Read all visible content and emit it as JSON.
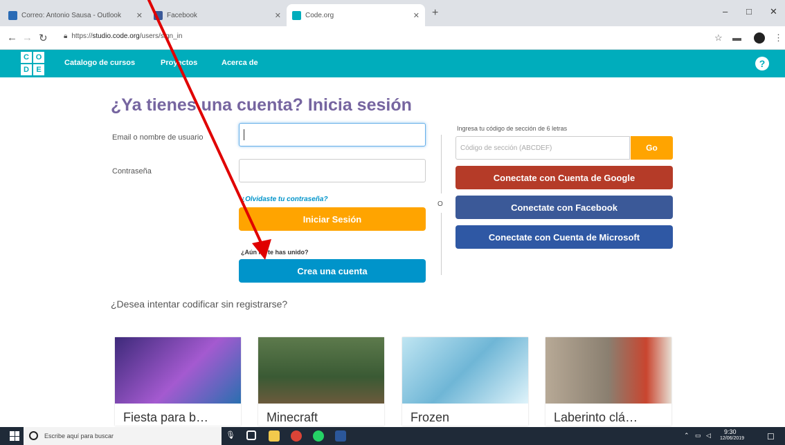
{
  "browser": {
    "tabs": [
      {
        "title": "Correo: Antonio Sausa - Outlook",
        "favicon_color": "#2a6bb5"
      },
      {
        "title": "Facebook",
        "favicon_color": "#3b5998"
      },
      {
        "title": "Code.org",
        "favicon_color": "#00adbc"
      }
    ],
    "new_tab": "+",
    "window_controls": {
      "minimize": "–",
      "maximize": "□",
      "close": "✕"
    },
    "url_prefix": "https://",
    "url_host": "studio.code.org",
    "url_path": "/users/sign_in"
  },
  "site": {
    "logo": [
      "C",
      "O",
      "D",
      "E"
    ],
    "nav": {
      "catalog": "Catalogo de cursos",
      "projects": "Proyectos",
      "about": "Acerca de"
    },
    "help_icon": "?"
  },
  "signin": {
    "title": "¿Ya tienes una cuenta? Inicia sesión",
    "email_label": "Email o nombre de usuario",
    "email_value": "",
    "password_label": "Contraseña",
    "forgot_link": "¿Olvidaste tu contraseña?",
    "signin_button": "Iniciar Sesión",
    "not_joined": "¿Aún no te has unido?",
    "create_account_button": "Crea una cuenta",
    "or": "O",
    "section_code_label": "Ingresa tu código de sección de 6 letras",
    "section_code_placeholder": "Código de sección (ABCDEF)",
    "go_button": "Go",
    "google_button": "Conectate con Cuenta de Google",
    "facebook_button": "Conectate con Facebook",
    "microsoft_button": "Conectate con Cuenta de Microsoft"
  },
  "try_section": {
    "heading": "¿Desea intentar codificar sin registrarse?",
    "cards": [
      {
        "title": "Fiesta para b…",
        "thumb_color": "#6a3fa0"
      },
      {
        "title": "Minecraft",
        "thumb_color": "#4a6b3a"
      },
      {
        "title": "Frozen",
        "thumb_color": "#7fc3dc"
      },
      {
        "title": "Laberinto clá…",
        "thumb_color": "#8a7f70"
      }
    ]
  },
  "taskbar": {
    "search_placeholder": "Escribe aquí para buscar",
    "time": "9:30",
    "date": "12/06/2019"
  },
  "colors": {
    "brand_teal": "#00adbc",
    "title_purple": "#7665a0",
    "orange": "#ffa400",
    "blue": "#0094ca",
    "annotation_red": "#e00000"
  }
}
